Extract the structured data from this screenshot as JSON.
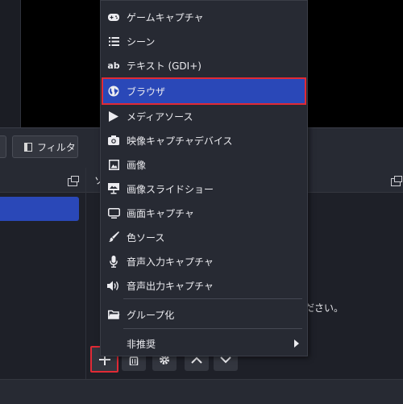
{
  "toolbar": {
    "filter_label": "フィルタ"
  },
  "sources_dock": {
    "title_partial": "ソ",
    "hint_text_partial": "ださい。"
  },
  "context_menu": {
    "items": [
      {
        "label": "ゲームキャプチャ",
        "icon": "gamepad-icon"
      },
      {
        "label": "シーン",
        "icon": "list-icon"
      },
      {
        "label": "テキスト (GDI+)",
        "icon": "text-ab-icon"
      },
      {
        "label": "ブラウザ",
        "icon": "globe-icon",
        "selected": true
      },
      {
        "label": "メディアソース",
        "icon": "play-icon"
      },
      {
        "label": "映像キャプチャデバイス",
        "icon": "camera-icon"
      },
      {
        "label": "画像",
        "icon": "image-icon"
      },
      {
        "label": "画像スライドショー",
        "icon": "slideshow-icon"
      },
      {
        "label": "画面キャプチャ",
        "icon": "monitor-icon"
      },
      {
        "label": "色ソース",
        "icon": "brush-icon"
      },
      {
        "label": "音声入力キャプチャ",
        "icon": "microphone-icon"
      },
      {
        "label": "音声出力キャプチャ",
        "icon": "speaker-icon"
      },
      {
        "label": "グループ化",
        "icon": "folder-icon"
      },
      {
        "label": "非推奨",
        "icon": "submenu-arrow-icon"
      }
    ]
  },
  "colors": {
    "accent": "#2a48b8",
    "highlight_border": "#e12a35",
    "menu_bg": "#272a33"
  }
}
